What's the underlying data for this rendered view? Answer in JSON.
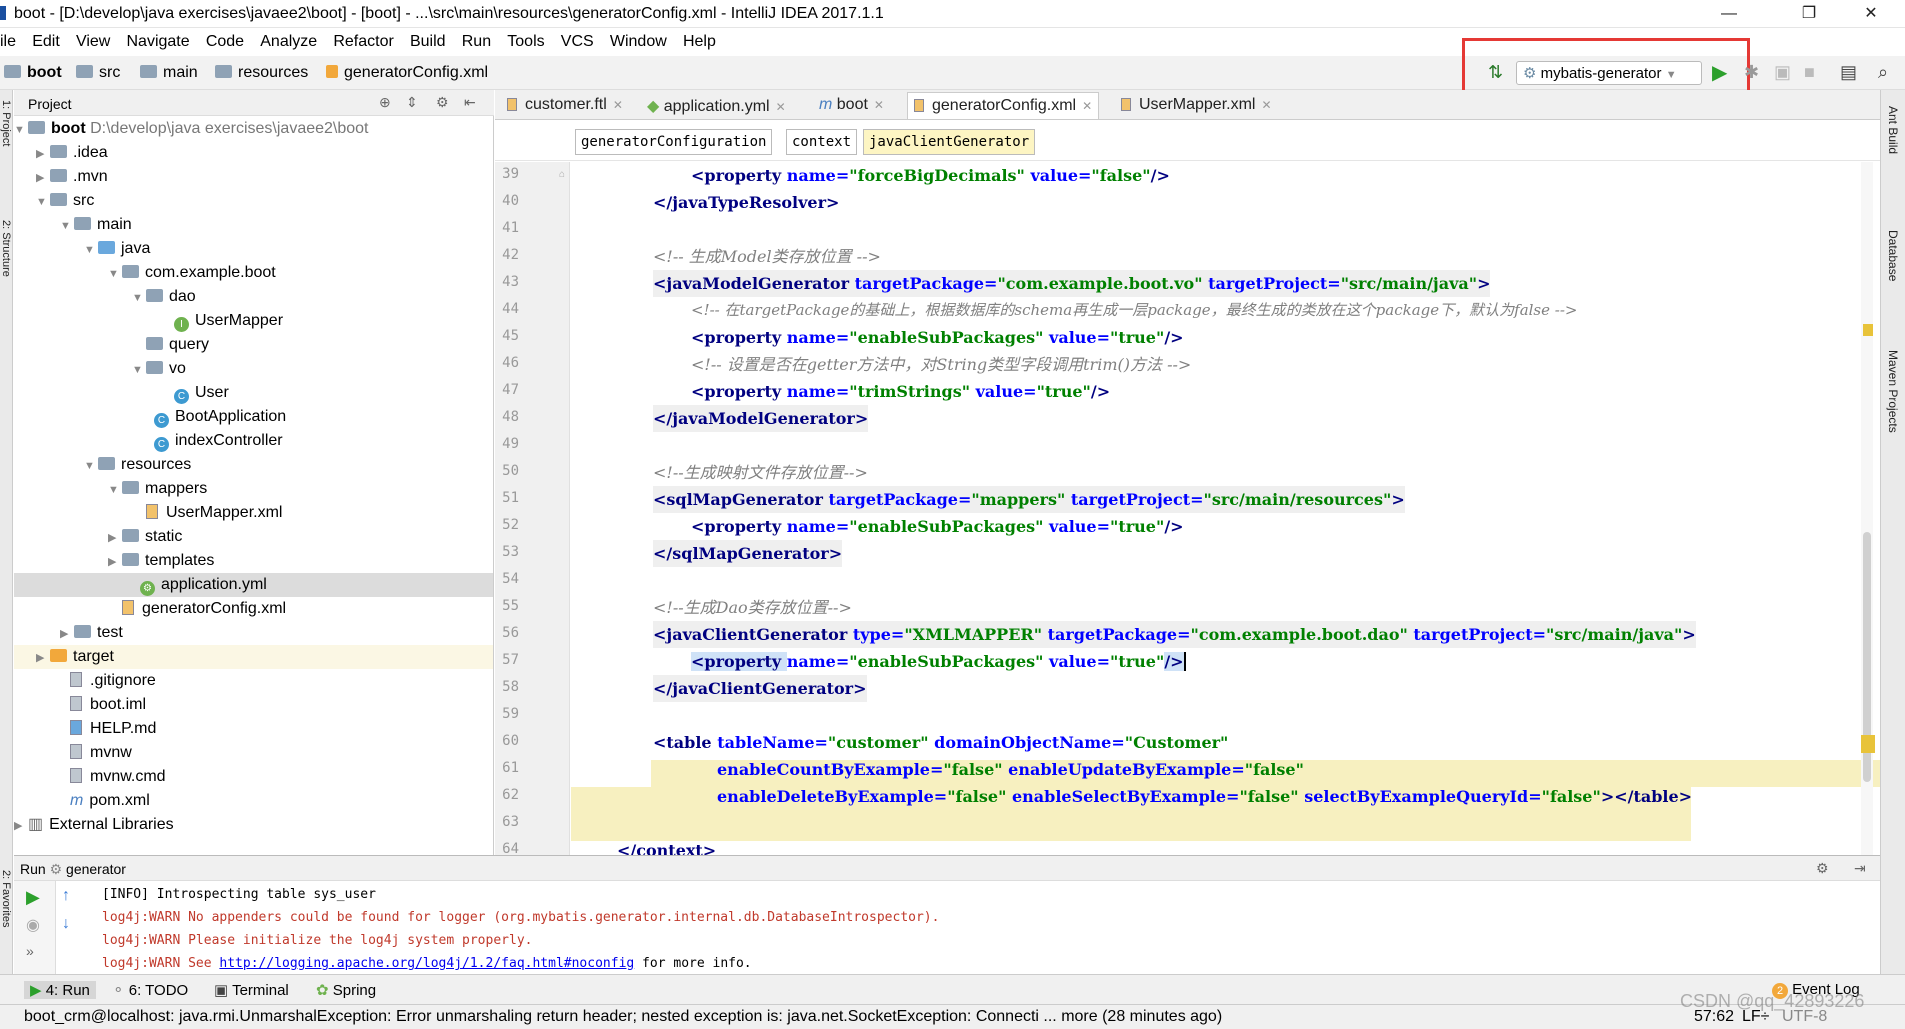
{
  "window": {
    "title": "boot - [D:\\develop\\java exercises\\javaee2\\boot] - [boot] - ...\\src\\main\\resources\\generatorConfig.xml - IntelliJ IDEA 2017.1.1"
  },
  "menu": [
    "ile",
    "Edit",
    "View",
    "Navigate",
    "Code",
    "Analyze",
    "Refactor",
    "Build",
    "Run",
    "Tools",
    "VCS",
    "Window",
    "Help"
  ],
  "nav": {
    "crumbs": [
      "boot",
      "src",
      "main",
      "resources",
      "generatorConfig.xml"
    ]
  },
  "toolbar": {
    "run_config": "mybatis-generator"
  },
  "project": {
    "header": "Project",
    "tree": [
      {
        "label": "boot",
        "extra": "D:\\develop\\java exercises\\javaee2\\boot"
      },
      {
        "label": ".idea"
      },
      {
        "label": ".mvn"
      },
      {
        "label": "src"
      },
      {
        "label": "main"
      },
      {
        "label": "java"
      },
      {
        "label": "com.example.boot"
      },
      {
        "label": "dao"
      },
      {
        "label": "UserMapper"
      },
      {
        "label": "query"
      },
      {
        "label": "vo"
      },
      {
        "label": "User"
      },
      {
        "label": "BootApplication"
      },
      {
        "label": "indexController"
      },
      {
        "label": "resources"
      },
      {
        "label": "mappers"
      },
      {
        "label": "UserMapper.xml"
      },
      {
        "label": "static"
      },
      {
        "label": "templates"
      },
      {
        "label": "application.yml"
      },
      {
        "label": "generatorConfig.xml"
      },
      {
        "label": "test"
      },
      {
        "label": "target"
      },
      {
        "label": ".gitignore"
      },
      {
        "label": "boot.iml"
      },
      {
        "label": "HELP.md"
      },
      {
        "label": "mvnw"
      },
      {
        "label": "mvnw.cmd"
      },
      {
        "label": "pom.xml"
      },
      {
        "label": "External Libraries"
      }
    ]
  },
  "tabs": [
    "customer.ftl",
    "application.yml",
    "boot",
    "generatorConfig.xml",
    "UserMapper.xml"
  ],
  "editor_breadcrumbs": [
    "generatorConfiguration",
    "context",
    "javaClientGenerator"
  ],
  "line_numbers": [
    "39",
    "40",
    "41",
    "42",
    "43",
    "44",
    "45",
    "46",
    "47",
    "48",
    "49",
    "50",
    "51",
    "52",
    "53",
    "54",
    "55",
    "56",
    "57",
    "58",
    "59",
    "60",
    "61",
    "62",
    "63",
    "64"
  ],
  "code": {
    "l39": {
      "a": "<property ",
      "b": "name=",
      "c": "\"forceBigDecimals\"",
      "d": " value=",
      "e": "\"false\"",
      "f": "/>"
    },
    "l40": "</javaTypeResolver>",
    "l42": "<!-- 生成Model类存放位置 -->",
    "l43": {
      "a": "<javaModelGenerator ",
      "b": "targetPackage=",
      "c": "\"com.example.boot.vo\"",
      "d": " targetProject=",
      "e": "\"src/main/java\"",
      "f": ">"
    },
    "l44": "<!-- 在targetPackage的基础上，根据数据库的schema再生成一层package，最终生成的类放在这个package下，默认为false -->",
    "l45": {
      "a": "<property ",
      "b": "name=",
      "c": "\"enableSubPackages\"",
      "d": " value=",
      "e": "\"true\"",
      "f": "/>"
    },
    "l46": "<!-- 设置是否在getter方法中，对String类型字段调用trim()方法 -->",
    "l47": {
      "a": "<property ",
      "b": "name=",
      "c": "\"trimStrings\"",
      "d": " value=",
      "e": "\"true\"",
      "f": "/>"
    },
    "l48": "</javaModelGenerator>",
    "l50": "<!--生成映射文件存放位置-->",
    "l51": {
      "a": "<sqlMapGenerator ",
      "b": "targetPackage=",
      "c": "\"mappers\"",
      "d": " targetProject=",
      "e": "\"src/main/resources\"",
      "f": ">"
    },
    "l52": {
      "a": "<property ",
      "b": "name=",
      "c": "\"enableSubPackages\"",
      "d": " value=",
      "e": "\"true\"",
      "f": "/>"
    },
    "l53": "</sqlMapGenerator>",
    "l55": "<!--生成Dao类存放位置-->",
    "l56": {
      "a": "<javaClientGenerator ",
      "b": "type=",
      "c": "\"XMLMAPPER\"",
      "d": " targetPackage=",
      "e": "\"com.example.boot.dao\"",
      "g": " targetProject=",
      "h": "\"src/main/java\"",
      "f": ">"
    },
    "l57": {
      "a": "<property ",
      "b": "name=",
      "c": "\"enableSubPackages\"",
      "d": " value=",
      "e": "\"true\"",
      "f": "/>"
    },
    "l58": "</javaClientGenerator>",
    "l60": {
      "a": "<table ",
      "b": "tableName=",
      "c": "\"customer\"",
      "d": " domainObjectName=",
      "e": "\"Customer\""
    },
    "l61": {
      "b": "enableCountByExample=",
      "c": "\"false\"",
      "d": " enableUpdateByExample=",
      "e": "\"false\""
    },
    "l62": {
      "b": "enableDeleteByExample=",
      "c": "\"false\"",
      "d": " enableSelectByExample=",
      "e": "\"false\"",
      "g": " selectByExampleQueryId=",
      "h": "\"false\"",
      "f": "></table>"
    },
    "l64": "</context>"
  },
  "run": {
    "label": "Run",
    "config": "generator",
    "lines": [
      "[INFO] Introspecting table sys_user",
      "log4j:WARN No appenders could be found for logger (org.mybatis.generator.internal.db.DatabaseIntrospector).",
      "log4j:WARN Please initialize the log4j system properly.",
      "log4j:WARN See "
    ],
    "link": "http://logging.apache.org/log4j/1.2/faq.html#noconfig",
    "link_suffix": " for more info."
  },
  "bottom_tools": [
    "4: Run",
    "6: TODO",
    "Terminal",
    "Spring"
  ],
  "event_log": {
    "count": "2",
    "label": "Event Log"
  },
  "status": {
    "message": "boot_crm@localhost: java.rmi.UnmarshalException: Error unmarshaling return header; nested exception is: java.net.SocketException: Connecti ... more (28 minutes ago)",
    "position": "57:62",
    "line_sep": "LF÷",
    "encoding": "UTF-8",
    "watermark": "CSDN @qq_42893226"
  },
  "side_tools": {
    "left": [
      "1: Project",
      "2: Structure",
      "2: Favorites"
    ],
    "right": [
      "Ant Build",
      "Database",
      "Maven Projects"
    ]
  }
}
